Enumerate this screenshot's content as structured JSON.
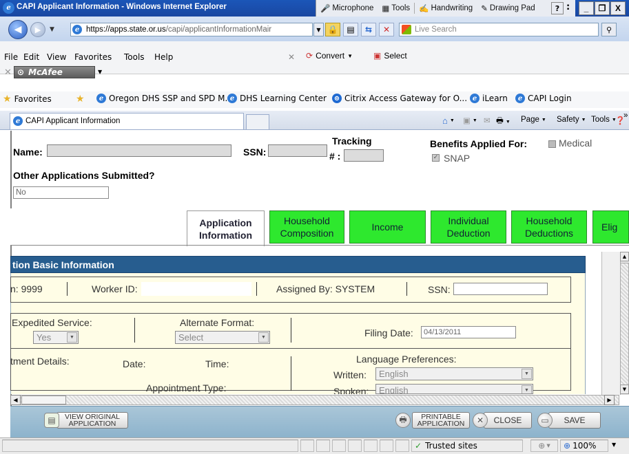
{
  "window": {
    "title": "CAPI Applicant Information - Windows Internet Explorer",
    "ink_toolbar": [
      "Microphone",
      "Tools",
      "Handwriting",
      "Drawing Pad"
    ],
    "help": "?",
    "colon": ":",
    "controls": {
      "minimize": "_",
      "restore": "͸",
      "close": "X"
    }
  },
  "address": {
    "url": "https://apps.state.or.us/capi/applicantInformationMair",
    "url_domain": "https://apps.state.or.us",
    "url_path": "/capi/applicantInformationMair",
    "search_placeholder": "Live Search"
  },
  "menu": {
    "items": [
      "File",
      "Edit",
      "View",
      "Favorites",
      "Tools",
      "Help"
    ],
    "convert": "Convert",
    "select": "Select",
    "mcafee": "McAfee"
  },
  "favorites": {
    "label": "Favorites",
    "links": [
      "Oregon DHS SSP and SPD M...",
      "DHS Learning Center",
      "Citrix Access Gateway for O...",
      "iLearn",
      "CAPI Login"
    ]
  },
  "tab": {
    "current": "CAPI Applicant Information",
    "commands": [
      "Page",
      "Safety",
      "Tools"
    ],
    "more": "»"
  },
  "applicant": {
    "name_label": "Name:",
    "ssn_label": "SSN:",
    "tracking_label_1": "Tracking",
    "tracking_label_2": "# :",
    "benefits_label": "Benefits Applied For:",
    "benefit_medical": "Medical",
    "benefit_snap": "SNAP",
    "other_apps_label": "Other Applications Submitted?",
    "other_apps_value": "No"
  },
  "page_tabs": [
    {
      "line1": "Application",
      "line2": "Information",
      "active": true
    },
    {
      "line1": "Household",
      "line2": "Composition",
      "active": false
    },
    {
      "line1": "Income",
      "line2": "",
      "active": false
    },
    {
      "line1": "Individual",
      "line2": "Deduction",
      "active": false
    },
    {
      "line1": "Household",
      "line2": "Deductions",
      "active": false
    },
    {
      "line1": "Elig",
      "line2": "",
      "active": false
    }
  ],
  "section": {
    "title": "tion Basic Information",
    "branch": "n: 9999",
    "worker_id_label": "Worker ID:",
    "assigned_by": "Assigned By: SYSTEM",
    "ssn_label": "SSN:",
    "expedited_label": "Expedited Service:",
    "expedited_value": "Yes",
    "alt_format_label": "Alternate Format:",
    "alt_format_value": "Select",
    "filing_date_label": "Filing Date:",
    "filing_date_value": "04/13/2011",
    "appt_details_label": "tment Details:",
    "date_label": "Date:",
    "time_label": "Time:",
    "appt_type_label": "Appointment Type:",
    "lang_pref_label": "Language Preferences:",
    "written_label": "Written:",
    "written_value": "English",
    "spoken_label": "Spoken:",
    "spoken_value": "English"
  },
  "actions": {
    "view_original_1": "VIEW ORIGINAL",
    "view_original_2": "APPLICATION",
    "printable_1": "PRINTABLE",
    "printable_2": "APPLICATION",
    "close": "CLOSE",
    "save": "SAVE"
  },
  "status": {
    "zone": "Trusted sites",
    "zoom": "100%"
  }
}
